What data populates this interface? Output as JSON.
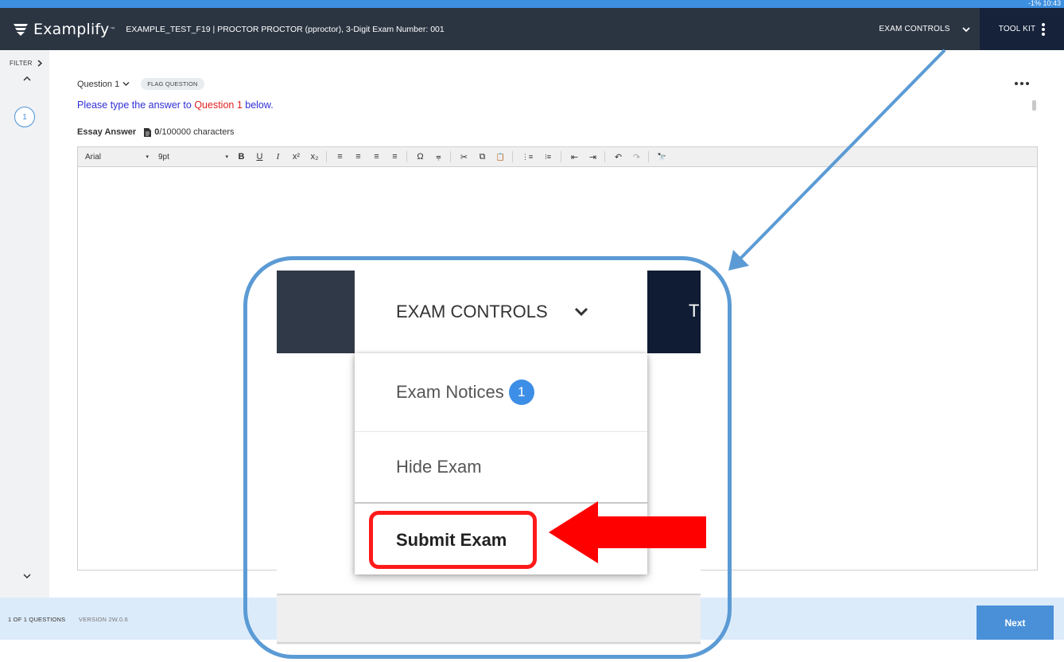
{
  "status_bar": {
    "text": "-1% 10:43"
  },
  "header": {
    "brand": "Examplify",
    "brand_tm": "™",
    "exam_title": "EXAMPLE_TEST_F19 | PROCTOR PROCTOR (pproctor), 3-Digit Exam Number: 001",
    "exam_controls_label": "EXAM CONTROLS",
    "toolkit_label": "TOOL KIT"
  },
  "left_rail": {
    "filter_label": "FILTER",
    "question_number": "1"
  },
  "question": {
    "label": "Question 1",
    "flag_label": "FLAG QUESTION",
    "prompt_prefix": "Please type the answer to ",
    "prompt_highlight": "Question 1",
    "prompt_suffix": " below.",
    "essay_label": "Essay Answer",
    "char_count": "0",
    "char_limit": "/100000 characters"
  },
  "toolbar": {
    "font": "Arial",
    "size": "9pt",
    "caret": "▾",
    "buttons": [
      "B",
      "U",
      "I",
      "x²",
      "x₂",
      "≡",
      "≡",
      "≡",
      "≡",
      "Ω",
      "⩦",
      "✂",
      "⧉",
      "📋",
      "⋮≡",
      "⁝≡",
      "⇤",
      "⇥",
      "↶",
      "↷",
      "🔭"
    ]
  },
  "footer": {
    "count": "1 OF 1 QUESTIONS",
    "version": "VERSION 2W.0.6",
    "next_label": "Next"
  },
  "callout": {
    "exam_controls_label": "EXAM CONTROLS",
    "toolkit_partial": "T",
    "menu": {
      "notices_label": "Exam Notices",
      "notices_badge": "1",
      "hide_label": "Hide Exam",
      "submit_label": "Submit Exam"
    }
  },
  "colors": {
    "header_bg": "#2b3542",
    "toolkit_bg": "#15223a",
    "accent_blue": "#4a90d9",
    "callout_blue": "#5b9bd5",
    "highlight_red": "#ff1a1a",
    "footer_bg": "#dcebfa"
  }
}
